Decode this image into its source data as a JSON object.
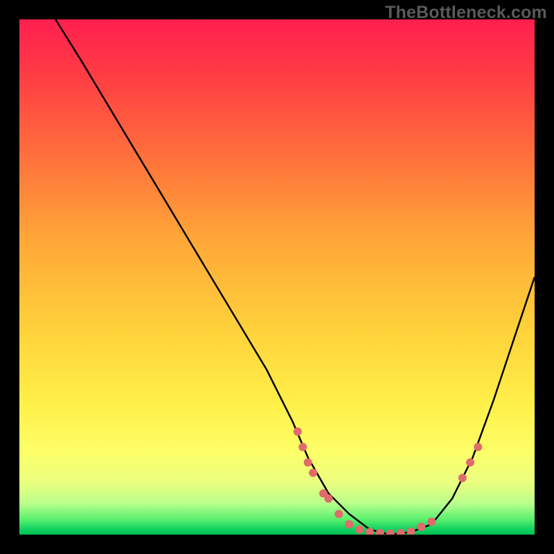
{
  "watermark": "TheBottleneck.com",
  "chart_data": {
    "type": "line",
    "title": "",
    "xlabel": "",
    "ylabel": "",
    "xlim": [
      0,
      100
    ],
    "ylim": [
      0,
      100
    ],
    "grid": false,
    "series": [
      {
        "name": "bottleneck-curve",
        "color": "#000000",
        "x": [
          7,
          12,
          18,
          24,
          30,
          36,
          42,
          48,
          53,
          56,
          60,
          64,
          68,
          72,
          76,
          80,
          84,
          88,
          92,
          96,
          100
        ],
        "y": [
          100,
          92,
          82,
          72,
          62,
          52,
          42,
          32,
          22,
          15,
          8,
          4,
          1,
          0,
          0.5,
          2,
          7,
          15,
          26,
          38,
          50
        ]
      }
    ],
    "scatter": {
      "name": "highlight-dots",
      "color": "#e06b6b",
      "points": [
        {
          "x": 54,
          "y": 20
        },
        {
          "x": 55,
          "y": 17
        },
        {
          "x": 56,
          "y": 14
        },
        {
          "x": 57,
          "y": 12
        },
        {
          "x": 59,
          "y": 8
        },
        {
          "x": 60,
          "y": 7
        },
        {
          "x": 62,
          "y": 4
        },
        {
          "x": 64,
          "y": 2
        },
        {
          "x": 66,
          "y": 1
        },
        {
          "x": 68,
          "y": 0.5
        },
        {
          "x": 70,
          "y": 0.3
        },
        {
          "x": 72,
          "y": 0.2
        },
        {
          "x": 74,
          "y": 0.3
        },
        {
          "x": 76,
          "y": 0.6
        },
        {
          "x": 78,
          "y": 1.5
        },
        {
          "x": 80,
          "y": 2.5
        },
        {
          "x": 86,
          "y": 11
        },
        {
          "x": 87.5,
          "y": 14
        },
        {
          "x": 89,
          "y": 17
        }
      ]
    }
  }
}
